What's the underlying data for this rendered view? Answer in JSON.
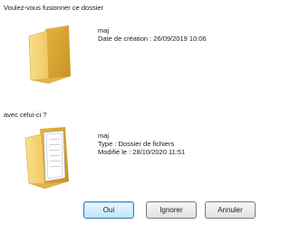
{
  "dialog": {
    "prompt_merge": "Voulez-vous fusionner ce dossier",
    "prompt_with": "avec celui-ci ?"
  },
  "source_folder": {
    "icon": "folder-icon",
    "name": "maj",
    "created": "Date de création : 26/09/2019 10:06"
  },
  "target_folder": {
    "icon": "folder-with-documents-icon",
    "name": "maj",
    "type": "Type : Dossier de fichiers",
    "modified": "Modifié le : 28/10/2020 11:51"
  },
  "buttons": {
    "yes": "Oui",
    "ignore": "Ignorer",
    "cancel": "Annuler"
  },
  "colors": {
    "folder": "#f0c75e",
    "default_button_border": "#3c7fb1"
  }
}
